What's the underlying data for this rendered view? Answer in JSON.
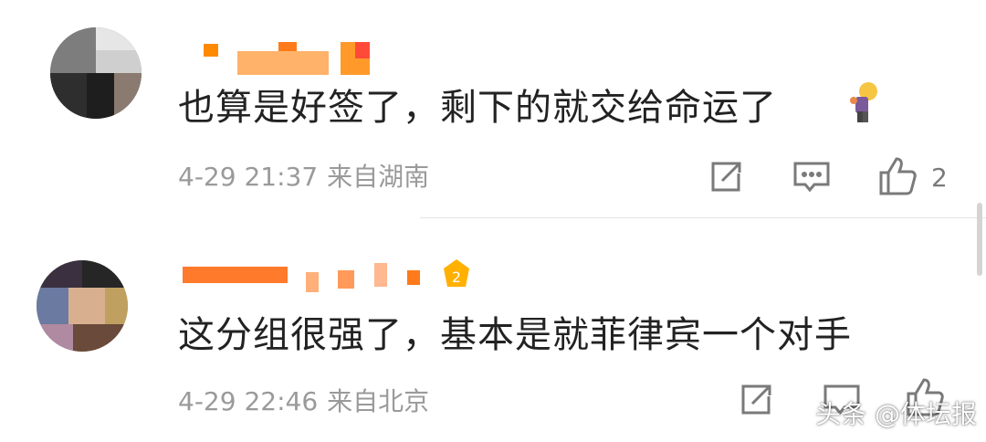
{
  "comments": [
    {
      "text": "也算是好签了，剩下的就交给命运了",
      "date": "4-29 21:37",
      "location": "来自湖南",
      "likes": "2"
    },
    {
      "text": "这分组很强了，基本是就菲律宾一个对手",
      "date": "4-29 22:46",
      "location": "来自北京"
    }
  ],
  "watermark": "头条 @体坛报",
  "icons": {
    "repost": "repost-icon",
    "comment": "comment-icon",
    "like": "like-icon",
    "emoji": "person-emoji-icon",
    "badge": "level-badge-icon"
  },
  "colors": {
    "text": "#222222",
    "meta": "#9a9a9a",
    "icon": "#7a7a7a",
    "username_accent": "#ff8a00"
  }
}
